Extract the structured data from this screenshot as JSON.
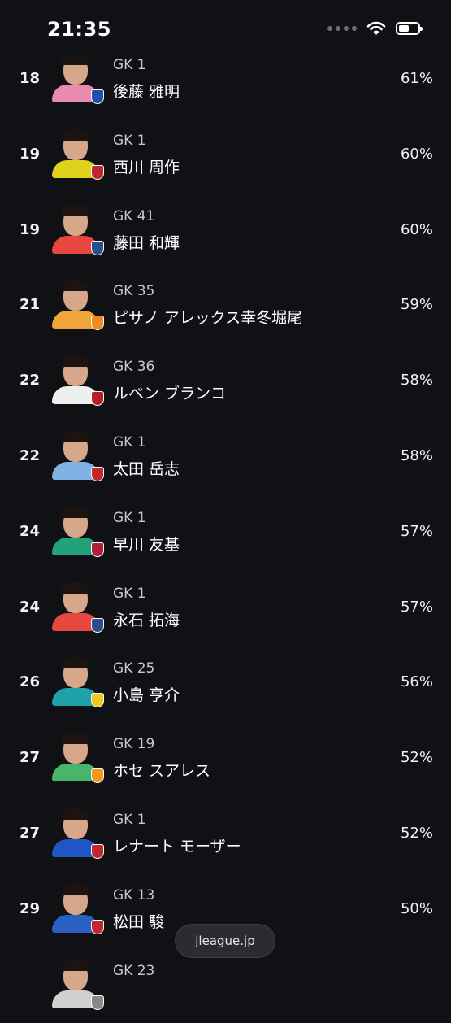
{
  "status_bar": {
    "time": "21:35",
    "battery_level": 0.55
  },
  "players": [
    {
      "rank": "18",
      "position": "GK 1",
      "name": "後藤 雅明",
      "percent": "61%",
      "shirt": "#e98ab0",
      "badge": "#1f4fa8"
    },
    {
      "rank": "19",
      "position": "GK 1",
      "name": "西川 周作",
      "percent": "60%",
      "shirt": "#e0d21c",
      "badge": "#c0282d"
    },
    {
      "rank": "19",
      "position": "GK 41",
      "name": "藤田 和輝",
      "percent": "60%",
      "shirt": "#e8473f",
      "badge": "#2a4f8c"
    },
    {
      "rank": "21",
      "position": "GK 35",
      "name": "ピサノ アレックス幸冬堀尾",
      "percent": "59%",
      "shirt": "#f0a53a",
      "badge": "#f08a20"
    },
    {
      "rank": "22",
      "position": "GK 36",
      "name": "ルベン ブランコ",
      "percent": "58%",
      "shirt": "#eef0ee",
      "badge": "#b52026"
    },
    {
      "rank": "22",
      "position": "GK 1",
      "name": "太田 岳志",
      "percent": "58%",
      "shirt": "#7fb3e6",
      "badge": "#c0282d"
    },
    {
      "rank": "24",
      "position": "GK 1",
      "name": "早川 友基",
      "percent": "57%",
      "shirt": "#23a178",
      "badge": "#b01f3a"
    },
    {
      "rank": "24",
      "position": "GK 1",
      "name": "永石 拓海",
      "percent": "57%",
      "shirt": "#e8473f",
      "badge": "#2a4f8c"
    },
    {
      "rank": "26",
      "position": "GK 25",
      "name": "小島 亨介",
      "percent": "56%",
      "shirt": "#1fa3a8",
      "badge": "#f2c820"
    },
    {
      "rank": "27",
      "position": "GK 19",
      "name": "ホセ スアレス",
      "percent": "52%",
      "shirt": "#49b56a",
      "badge": "#f29a1a"
    },
    {
      "rank": "27",
      "position": "GK 1",
      "name": "レナート モーザー",
      "percent": "52%",
      "shirt": "#2056c8",
      "badge": "#c0282d"
    },
    {
      "rank": "29",
      "position": "GK 13",
      "name": "松田 駿",
      "percent": "50%",
      "shirt": "#2a5fc4",
      "badge": "#c0282d"
    },
    {
      "rank": "",
      "position": "GK 23",
      "name": "",
      "percent": "",
      "shirt": "#d0d0d0",
      "badge": "#888888"
    }
  ],
  "browser": {
    "url": "jleague.jp"
  }
}
